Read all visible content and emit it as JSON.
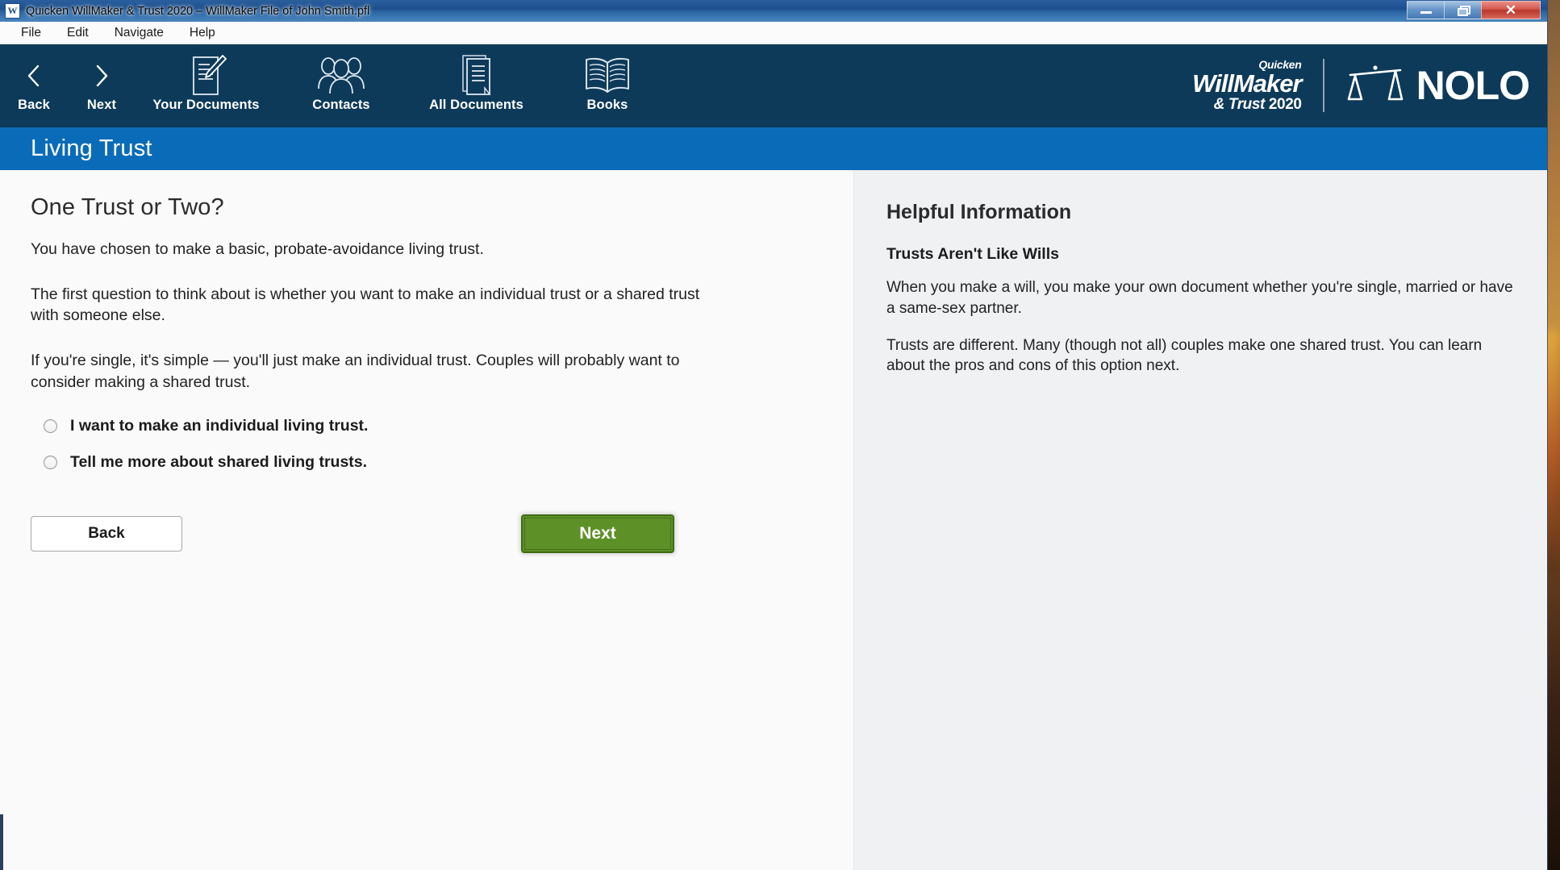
{
  "window": {
    "title": "Quicken WillMaker & Trust 2020 – WillMaker File of John Smith.pfl",
    "icon_letter": "W",
    "controls": {
      "minimize": "minimize-icon",
      "maximize": "restore-icon",
      "close": "✕"
    }
  },
  "menubar": {
    "items": [
      {
        "label": "File"
      },
      {
        "label": "Edit"
      },
      {
        "label": "Navigate"
      },
      {
        "label": "Help"
      }
    ]
  },
  "toolbar": {
    "items": [
      {
        "label": "Back",
        "icon": "chevron-left-icon"
      },
      {
        "label": "Next",
        "icon": "chevron-right-icon"
      },
      {
        "label": "Your Documents",
        "icon": "document-pencil-icon"
      },
      {
        "label": "Contacts",
        "icon": "people-group-icon"
      },
      {
        "label": "All Documents",
        "icon": "stacked-documents-icon"
      },
      {
        "label": "Books",
        "icon": "open-book-icon"
      }
    ],
    "brand": {
      "quicken": "Quicken",
      "willmaker": "WillMaker",
      "amp": "&",
      "trust": "Trust",
      "year": "2020",
      "nolo": "NOLO",
      "nolo_icon": "scales-of-justice-icon"
    }
  },
  "section": {
    "title": "Living Trust"
  },
  "main": {
    "heading": "One Trust or Two?",
    "paragraphs": [
      "You have chosen to make a basic, probate-avoidance living trust.",
      "The first question to think about is whether you want to make an individual trust or a shared trust with someone else.",
      "If you're single, it's simple — you'll just make an individual trust. Couples will probably want to consider making a shared trust."
    ],
    "options": [
      {
        "label": "I want to make an individual living trust.",
        "selected": false
      },
      {
        "label": "Tell me more about shared living trusts.",
        "selected": false
      }
    ],
    "buttons": {
      "back": "Back",
      "next": "Next"
    }
  },
  "sidebar": {
    "heading": "Helpful Information",
    "subheading": "Trusts Aren't Like Wills",
    "paragraphs": [
      "When you make a will, you make your own document whether you're single, married or have a same-sex partner.",
      "Trusts are different. Many (though not all) couples make one shared trust. You can learn about the pros and cons of this option next."
    ]
  },
  "colors": {
    "toolbar_navy": "#0e3a5a",
    "section_blue": "#0a6cb8",
    "next_green": "#5e9028",
    "titlebar_blue": "#1d4f8c",
    "close_red": "#b8362a"
  }
}
